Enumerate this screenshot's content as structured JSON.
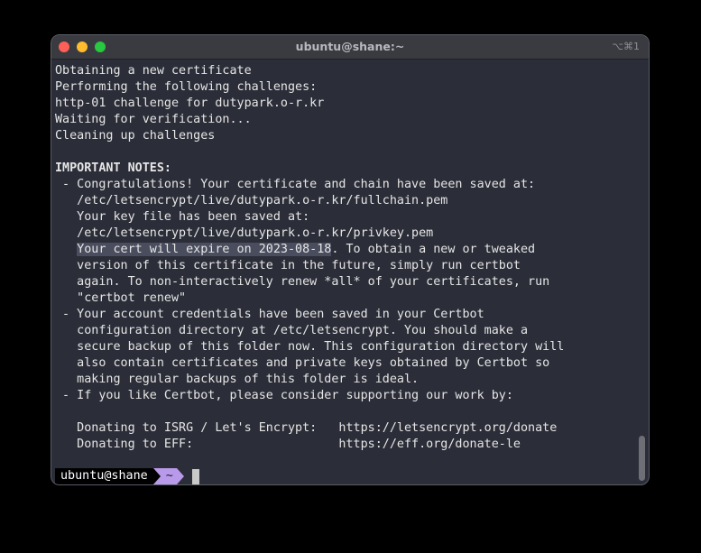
{
  "window": {
    "title": "ubuntu@shane:~",
    "shortcut": "⌥⌘1"
  },
  "terminal": {
    "lines": [
      "Obtaining a new certificate",
      "Performing the following challenges:",
      "http-01 challenge for dutypark.o-r.kr",
      "Waiting for verification...",
      "Cleaning up challenges",
      "",
      "IMPORTANT NOTES:",
      " - Congratulations! Your certificate and chain have been saved at:",
      "   /etc/letsencrypt/live/dutypark.o-r.kr/fullchain.pem",
      "   Your key file has been saved at:",
      "   /etc/letsencrypt/live/dutypark.o-r.kr/privkey.pem",
      "",
      "   version of this certificate in the future, simply run certbot",
      "   again. To non-interactively renew *all* of your certificates, run",
      "   \"certbot renew\"",
      " - Your account credentials have been saved in your Certbot",
      "   configuration directory at /etc/letsencrypt. You should make a",
      "   secure backup of this folder now. This configuration directory will",
      "   also contain certificates and private keys obtained by Certbot so",
      "   making regular backups of this folder is ideal.",
      " - If you like Certbot, please consider supporting our work by:",
      "",
      "   Donating to ISRG / Let's Encrypt:   https://letsencrypt.org/donate",
      "   Donating to EFF:                    https://eff.org/donate-le"
    ],
    "expire_indent": "   ",
    "expire_highlight": "Your cert will expire on 2023-08-18",
    "expire_rest": ". To obtain a new or tweaked"
  },
  "prompt": {
    "user_host": "ubuntu@shane",
    "directory": "~",
    "powerline_color": "#b999ea"
  }
}
